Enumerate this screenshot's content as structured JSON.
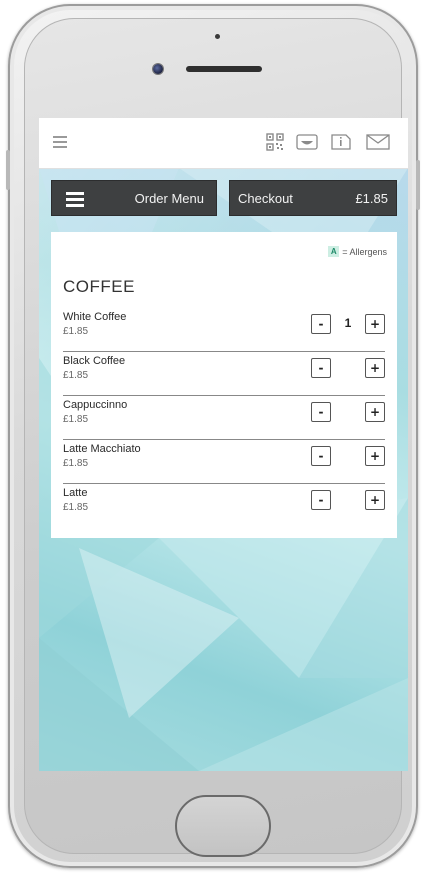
{
  "topbar": {
    "icons": [
      "menu-icon",
      "qr-code-icon",
      "bowl-icon",
      "info-icon",
      "mail-icon"
    ]
  },
  "nav": {
    "order_menu_label": "Order Menu",
    "checkout_label": "Checkout",
    "checkout_total": "£1.85"
  },
  "menu": {
    "allergen_badge": "A",
    "allergen_note": "= Allergens",
    "section_title": "COFFEE",
    "items": [
      {
        "name": "White Coffee",
        "price": "£1.85",
        "minus": "-",
        "plus": "+",
        "qty": "1"
      },
      {
        "name": "Black Coffee",
        "price": "£1.85",
        "minus": "-",
        "plus": "+",
        "qty": ""
      },
      {
        "name": "Cappuccinno",
        "price": "£1.85",
        "minus": "-",
        "plus": "+",
        "qty": ""
      },
      {
        "name": "Latte Macchiato",
        "price": "£1.85",
        "minus": "-",
        "plus": "+",
        "qty": ""
      },
      {
        "name": "Latte",
        "price": "£1.85",
        "minus": "-",
        "plus": "+",
        "qty": ""
      }
    ]
  },
  "colors": {
    "nav_button_bg": "#3e4041",
    "allergen_badge_bg": "#cdeee3",
    "allergen_badge_text": "#1f8a68"
  }
}
